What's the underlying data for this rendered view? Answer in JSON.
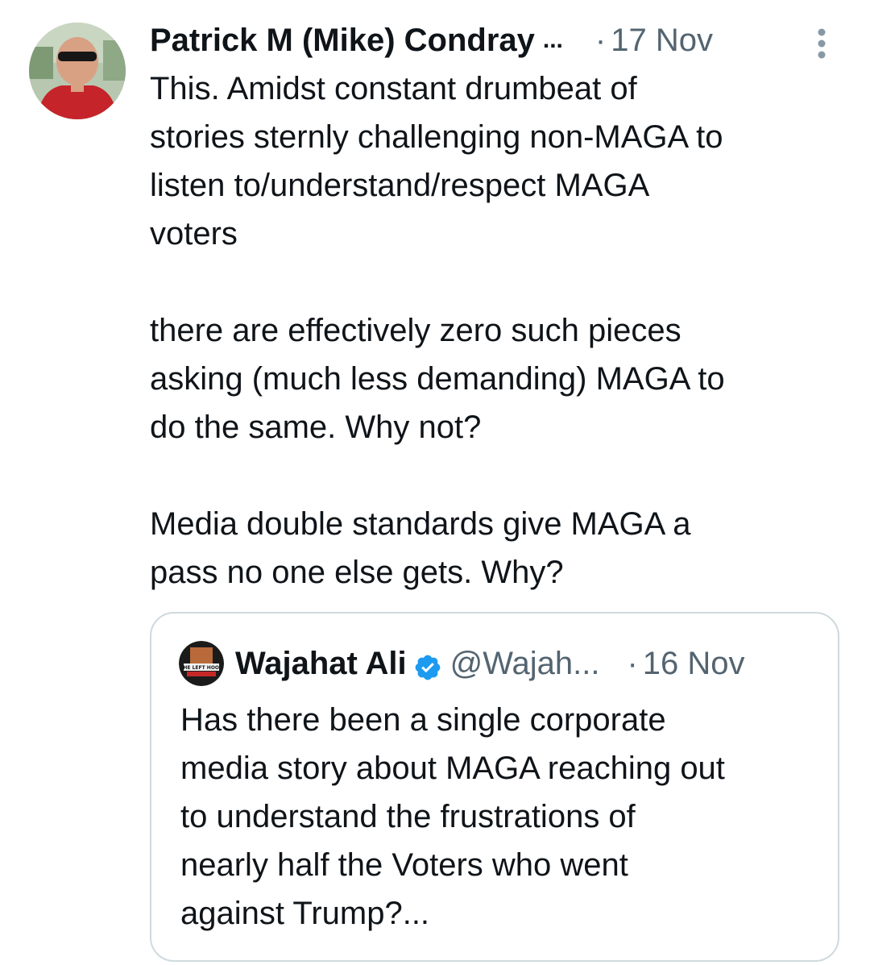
{
  "tweet": {
    "author_name": "Patrick M (Mike) Condray",
    "name_ellipsis": "...",
    "date_separator": "·",
    "date": "17 Nov",
    "more_icon": "vertical-ellipsis-icon",
    "paragraphs": [
      [
        "This. Amidst constant drumbeat of",
        "stories sternly challenging non-MAGA to",
        "listen to/understand/respect MAGA",
        "voters"
      ],
      [
        "there are effectively zero such pieces",
        "asking (much less demanding) MAGA to",
        "do the same. Why not?"
      ],
      [
        "Media double standards give MAGA a",
        "pass no one else gets. Why?"
      ]
    ]
  },
  "quoted_tweet": {
    "author_name": "Wajahat Ali",
    "verified": true,
    "verified_color": "#1d9bf0",
    "handle": "@Wajah...",
    "date_separator": "·",
    "date": "16 Nov",
    "avatar_text": "THE LEFT HOOK",
    "lines": [
      "Has there been a single corporate",
      "media story about MAGA reaching out",
      "to understand the frustrations of",
      "nearly half the Voters who went",
      "against Trump?..."
    ]
  },
  "colors": {
    "text_primary": "#0f1419",
    "text_secondary": "#536471",
    "border": "#cfd9de",
    "accent": "#1d9bf0"
  }
}
